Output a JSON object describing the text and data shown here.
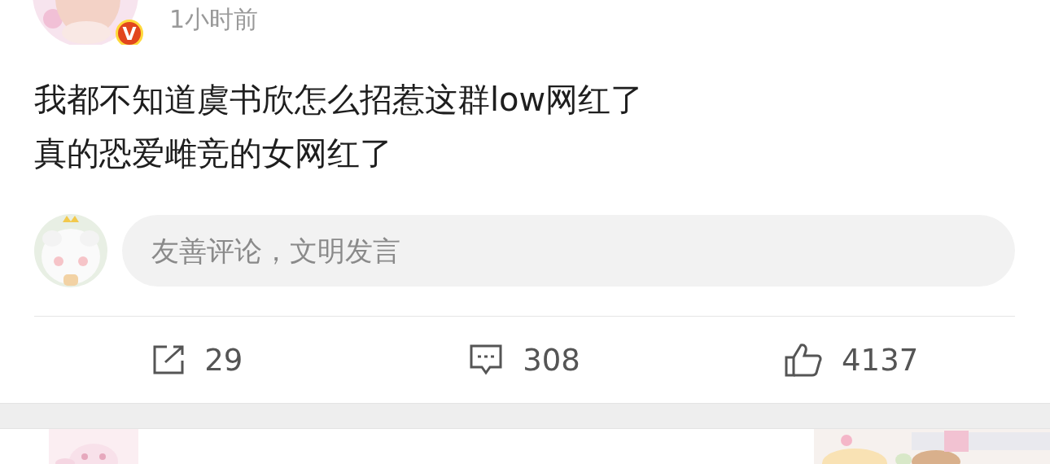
{
  "post": {
    "time": "1小时前",
    "verified_badge": "V",
    "lines": [
      "我都不知道虞书欣怎么招惹这群low网红了",
      "真的恐爱雌竞的女网红了"
    ]
  },
  "comment_box": {
    "placeholder": "友善评论，文明发言"
  },
  "actions": [
    {
      "kind": "share",
      "count": "29"
    },
    {
      "kind": "comment",
      "count": "308"
    },
    {
      "kind": "like",
      "count": "4137"
    }
  ]
}
